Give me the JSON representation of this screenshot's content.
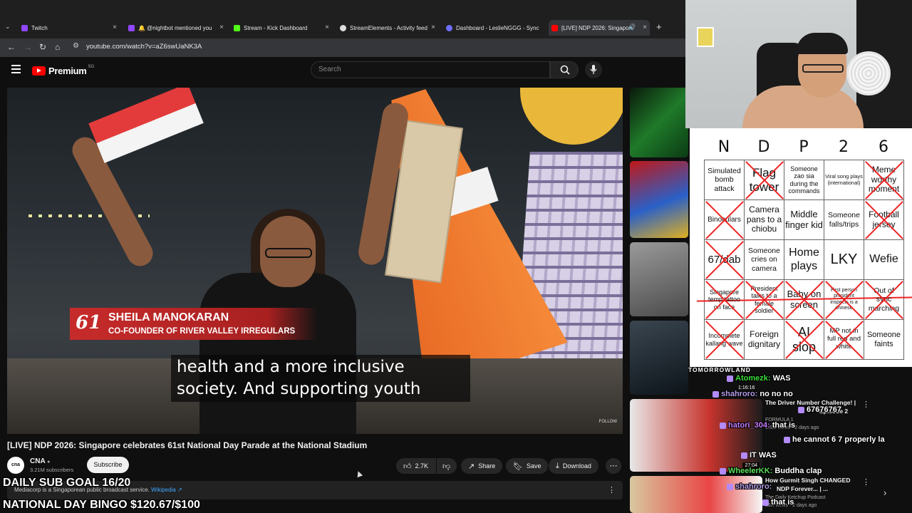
{
  "browser": {
    "tabs": [
      {
        "label": "Twitch",
        "color": "#9146ff"
      },
      {
        "label": "🔔 @nightbot mentioned you",
        "color": "#9146ff"
      },
      {
        "label": "Stream - Kick Dashboard",
        "color": "#53fc18"
      },
      {
        "label": "StreamElements - Activity feed",
        "color": "#dddddd"
      },
      {
        "label": "Dashboard - LeslieNGGG - Sync",
        "color": "#6d6dff"
      },
      {
        "label": "[LIVE] NDP 2026: Singapore",
        "color": "#ff0000"
      }
    ],
    "url": "youtube.com/watch?v=aZ6swUaNK3A"
  },
  "youtube": {
    "brand": "Premium",
    "region": "SG",
    "search_placeholder": "Search"
  },
  "video": {
    "lower_third_logo": "61",
    "lower_third_name": "SHEILA MANOKARAN",
    "lower_third_role": "CO-FOUNDER OF RIVER VALLEY IRREGULARS",
    "captions": [
      "health and a more inclusive",
      "society. And supporting youth"
    ],
    "watermark": "FOLLOW"
  },
  "video_info": {
    "title": "[LIVE] NDP 2026: Singapore celebrates 61st National Day Parade at the National Stadium",
    "channel_avatar": "cna",
    "channel_name": "CNA",
    "channel_subs": "3.21M subscribers",
    "subscribe_label": "Subscribe",
    "like_count": "2.7K",
    "share_label": "Share",
    "save_label": "Save",
    "download_label": "Download",
    "info_text": "Mediacorp is a Singaporean public broadcast service.",
    "info_link": "Wikipedia ↗"
  },
  "overlays": {
    "sub_goal": "DAILY SUB GOAL 16/20",
    "bingo_goal": "NATIONAL DAY BINGO $120.67/$100"
  },
  "recommendations": [
    {
      "title": "The Driver Number Challenge! |",
      "subtitle": "Episode 2",
      "channel": "FORMULA 1",
      "meta": "1.5M views · 2 days ago",
      "duration": "27:04"
    },
    {
      "title": "How Gurmit Singh CHANGED",
      "subtitle": "NDP Forever... | ...",
      "channel": "The Daily Ketchup Podcast",
      "meta": "86K views · 2 days ago",
      "duration": ""
    }
  ],
  "rec_overlay": {
    "tomorrowland": "TOMORROWLAND",
    "timestamp": "1:16:16"
  },
  "bingo": {
    "header": [
      "N",
      "D",
      "P",
      "2",
      "6"
    ],
    "cells": [
      {
        "text": "Simulated bomb attack",
        "size": 10.5,
        "marked": false
      },
      {
        "text": "Flag tower",
        "size": 17,
        "marked": true
      },
      {
        "text": "Someone zao sia during the commands",
        "size": 9,
        "marked": false
      },
      {
        "text": "Viral song plays (international)",
        "size": 7.5,
        "marked": false
      },
      {
        "text": "Meme worthy moment",
        "size": 12,
        "marked": true
      },
      {
        "text": "Binoculars",
        "size": 10,
        "marked": true
      },
      {
        "text": "Camera pans to a chiobu",
        "size": 12,
        "marked": false
      },
      {
        "text": "Middle finger kid",
        "size": 13,
        "marked": false
      },
      {
        "text": "Someone falls/trips",
        "size": 10.5,
        "marked": false
      },
      {
        "text": "Football jersey",
        "size": 12,
        "marked": true
      },
      {
        "text": "67/dab",
        "size": 15,
        "marked": true
      },
      {
        "text": "Someone cries on camera",
        "size": 10.5,
        "marked": false
      },
      {
        "text": "Home plays",
        "size": 16,
        "marked": false
      },
      {
        "text": "LKY",
        "size": 20,
        "marked": false
      },
      {
        "text": "Wefie",
        "size": 16,
        "marked": false
      },
      {
        "text": "Singapore temp tattoo on face",
        "size": 9,
        "marked": true
      },
      {
        "text": "President talks to a female soldier",
        "size": 9,
        "marked": true
      },
      {
        "text": "Baby on screen",
        "size": 13,
        "marked": true
      },
      {
        "text": "First person president inspects is a chinese",
        "size": 7,
        "marked": true
      },
      {
        "text": "Out of sync marching",
        "size": 10.5,
        "marked": true
      },
      {
        "text": "Incomplete kallang wave",
        "size": 9,
        "marked": true
      },
      {
        "text": "Foreign dignitary",
        "size": 12,
        "marked": false
      },
      {
        "text": "AI slop",
        "size": 18,
        "marked": true
      },
      {
        "text": "MP not in full red and white",
        "size": 9.5,
        "marked": true
      },
      {
        "text": "Someone faints",
        "size": 11,
        "marked": false
      }
    ]
  },
  "chat": [
    {
      "user": "Atomezk",
      "message": "WAS",
      "color": "#3adf3a"
    },
    {
      "user": "shahroro",
      "message": "no no no",
      "color": "#b49ce8"
    },
    {
      "user": "",
      "message": "67676767",
      "color": "#ffffff"
    },
    {
      "user": "hatori_304",
      "message": "that is",
      "color": "#c77dff"
    },
    {
      "user": "",
      "message": "he cannot 6 7 properly la",
      "color": "#ffffff"
    },
    {
      "user": "",
      "message": "IT WAS",
      "color": "#ffffff"
    },
    {
      "user": "WheelerKK",
      "message": "Buddha clap",
      "color": "#5be05b"
    },
    {
      "user": "shahroro",
      "message": "",
      "color": "#b49ce8"
    },
    {
      "user": "",
      "message": "that is",
      "color": "#ffffff"
    }
  ],
  "colors": {
    "accent_red": "#ff0000",
    "bingo_mark": "#ee2222",
    "link": "#3ea6ff"
  }
}
